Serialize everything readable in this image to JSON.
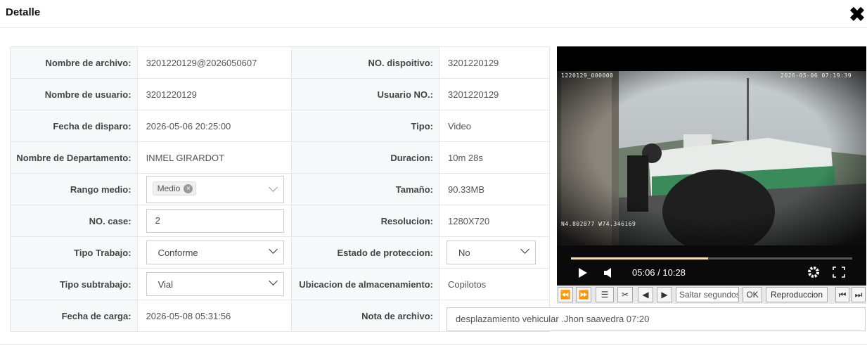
{
  "dialog": {
    "title": "Detalle",
    "close_icon": "close-icon"
  },
  "fields": {
    "file_name": {
      "label": "Nombre de archivo:",
      "value": "3201220129@2026050607"
    },
    "device_no": {
      "label": "NO. dispoitivo:",
      "value": "3201220129"
    },
    "user_name": {
      "label": "Nombre de usuario:",
      "value": "3201220129"
    },
    "user_no": {
      "label": "Usuario NO.:",
      "value": "3201220129"
    },
    "shot_date": {
      "label": "Fecha de disparo:",
      "value": "2026-05-06 20:25:00"
    },
    "type": {
      "label": "Tipo:",
      "value": "Video"
    },
    "department": {
      "label": "Nombre de Departamento:",
      "value": "INMEL GIRARDOT"
    },
    "duration": {
      "label": "Duracion:",
      "value": "10m 28s"
    },
    "media_range": {
      "label": "Rango medio:",
      "tag": "Medio"
    },
    "size": {
      "label": "Tamaño:",
      "value": "90.33MB"
    },
    "case_no": {
      "label": "NO. case:",
      "value": "2"
    },
    "resolution": {
      "label": "Resolucion:",
      "value": "1280X720"
    },
    "work_type": {
      "label": "Tipo Trabajo:",
      "value": "Conforme"
    },
    "protection": {
      "label": "Estado de proteccion:",
      "value": "No"
    },
    "work_subtype": {
      "label": "Tipo subtrabajo:",
      "value": "Vial"
    },
    "storage": {
      "label": "Ubicacion de almacenamiento:",
      "value": "Copilotos"
    },
    "upload_date": {
      "label": "Fecha de carga:",
      "value": "2026-05-08 05:31:56"
    },
    "file_note": {
      "label": "Nota de archivo:",
      "value": "desplazamiento vehicular .Jhon saavedra 07:20"
    }
  },
  "video": {
    "osd_id": "1220129_000000",
    "osd_datetime": "2026-05-06 07:19:39",
    "osd_gps": "N4.802877 W74.346169",
    "time_display": "05:06 / 10:28",
    "progress": 0.488,
    "progress_color": "#f2e3b5"
  },
  "toolbar": {
    "jump_placeholder": "Saltar segundos",
    "ok_label": "OK",
    "playback_label": "Reproduccion"
  }
}
